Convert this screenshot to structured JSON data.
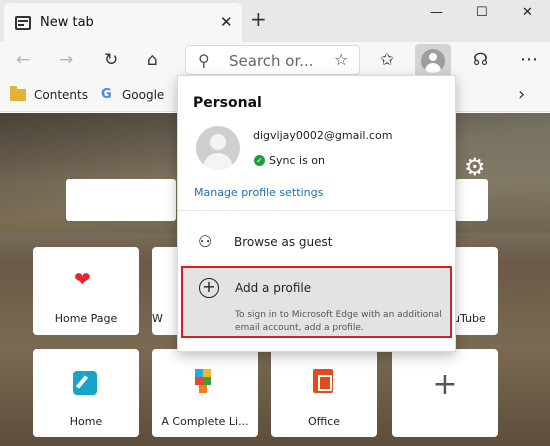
{
  "tab": {
    "title": "New tab",
    "close": "✕"
  },
  "newtab": "+",
  "window": {
    "minimize": "—",
    "maximize": "☐",
    "close": "✕"
  },
  "toolbar": {
    "back": "←",
    "forward": "→",
    "refresh": "↻",
    "home": "⌂",
    "search_icon": "⚲",
    "address_placeholder": "Search or...",
    "favorite_star": "☆",
    "favorites": "✩",
    "feedback": "☊"
  },
  "favorites_bar": {
    "items": [
      {
        "label": "Contents",
        "icon": "folder-icon"
      },
      {
        "label": "Google",
        "icon": "google-icon"
      }
    ],
    "more": "›"
  },
  "background": {
    "settings_icon": "⚙",
    "tiles": [
      {
        "label": "Home Page",
        "icon": "heart-icon"
      },
      {
        "label": "W",
        "icon": ""
      },
      {
        "label": "uTube",
        "icon": ""
      },
      {
        "label": "Home",
        "icon": "home-app-icon"
      },
      {
        "label": "A Complete Li...",
        "icon": "acl-icon"
      },
      {
        "label": "Office",
        "icon": "office-icon"
      },
      {
        "label": "+",
        "icon": "add-tile-icon"
      }
    ]
  },
  "profile_menu": {
    "heading": "Personal",
    "email": "digvijay0002@gmail.com",
    "sync_status": "Sync is on",
    "manage_link": "Manage profile settings",
    "guest_label": "Browse as guest",
    "add_profile": {
      "label": "Add a profile",
      "description": "To sign in to Microsoft Edge with an additional email account, add a profile."
    }
  },
  "colors": {
    "highlight_border": "#d81e1e",
    "link": "#1a6fb5",
    "sync_green": "#1a9e39"
  }
}
